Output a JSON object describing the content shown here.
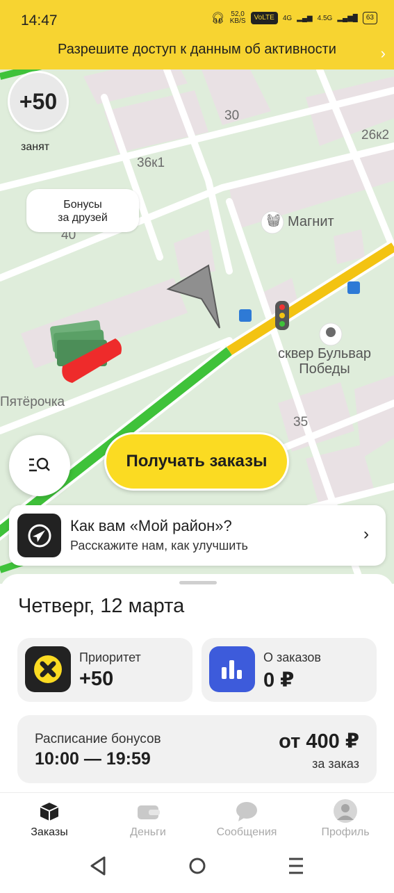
{
  "status_bar": {
    "time": "14:47",
    "speed_value": "52,0",
    "speed_unit": "KB/S",
    "volte": "VoLTE",
    "net_1": "4G",
    "net_2": "4.5G",
    "battery": "63"
  },
  "permission_banner": {
    "text": "Разрешите доступ к данным об активности"
  },
  "map": {
    "priority_badge": "+50",
    "busy_status": "занят",
    "bonus_bubble": "Бонусы\nза друзей",
    "labels": {
      "house_30": "30",
      "house_26k2": "26к2",
      "house_36k1": "36к1",
      "house_40": "40",
      "magnit": "Магнит",
      "park": "сквер Бульвар\nПобеды",
      "pyaterochka": "Пятёрочка",
      "house_35": "35"
    },
    "get_orders_button": "Получать заказы"
  },
  "district_card": {
    "title": "Как вам «Мой район»?",
    "subtitle": "Расскажите нам, как улучшить"
  },
  "sheet": {
    "date": "Четверг, 12 марта",
    "priority_tile": {
      "label": "Приоритет",
      "value": "+50"
    },
    "orders_tile": {
      "label": "О заказов",
      "value": "0 ₽"
    },
    "schedule": {
      "label": "Расписание бонусов",
      "time": "10:00 — 19:59",
      "amount": "от 400 ₽",
      "per": "за заказ"
    }
  },
  "tabs": [
    {
      "label": "Заказы",
      "icon": "box-icon",
      "active": true
    },
    {
      "label": "Деньги",
      "icon": "wallet-icon",
      "active": false
    },
    {
      "label": "Сообщения",
      "icon": "chat-icon",
      "active": false
    },
    {
      "label": "Профиль",
      "icon": "avatar-icon",
      "active": false
    }
  ],
  "colors": {
    "yellow": "#f7d431",
    "button_yellow": "#fbdb22",
    "route_green": "#3fc23a",
    "blue_tile": "#3d5bdb"
  }
}
